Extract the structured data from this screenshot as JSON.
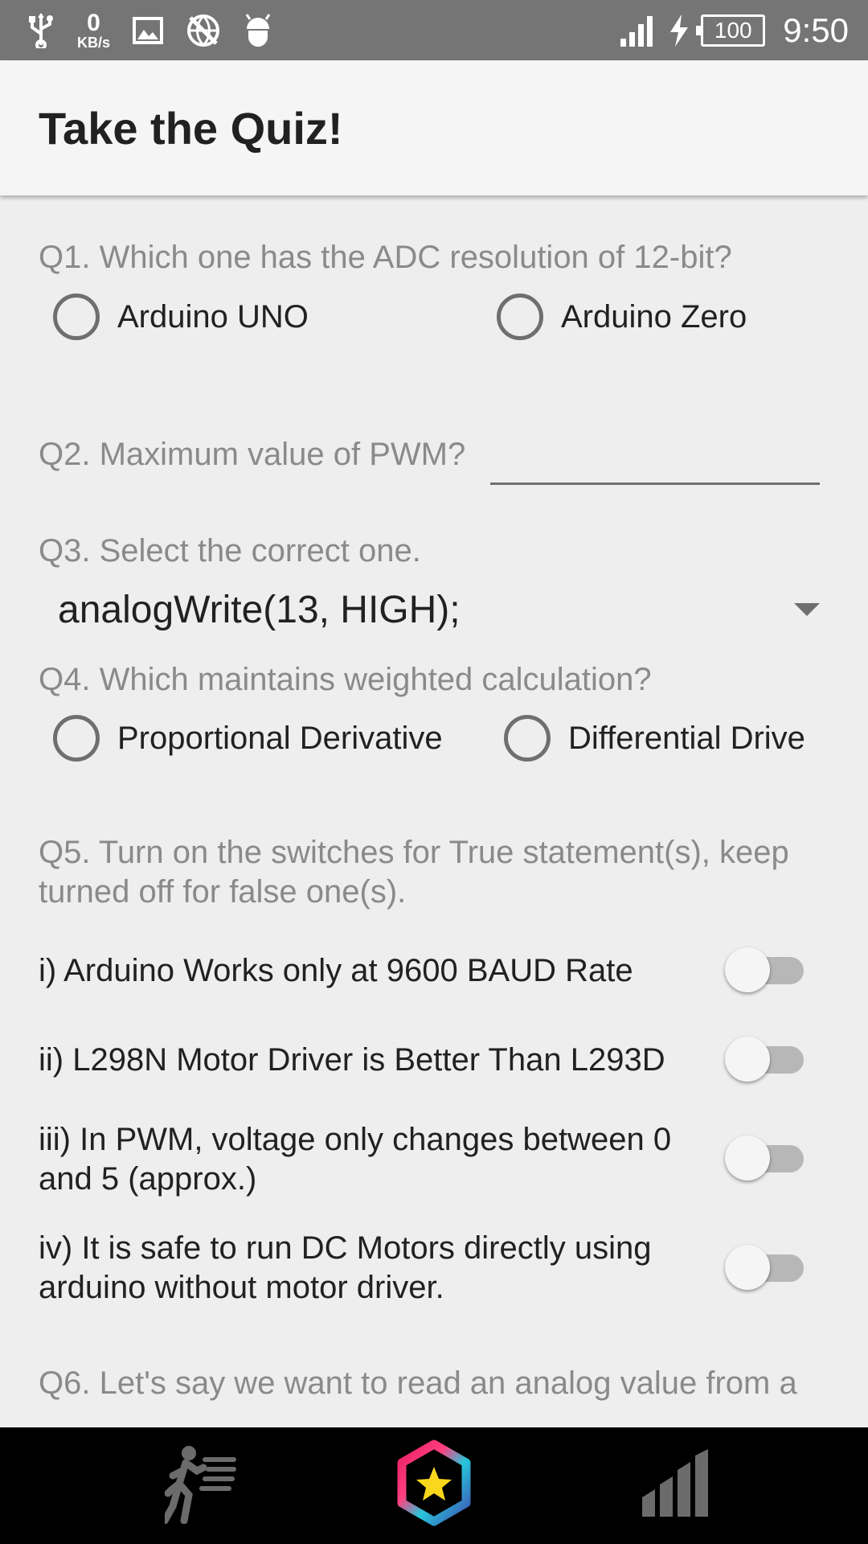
{
  "status_bar": {
    "speed_value": "0",
    "speed_unit": "KB/s",
    "battery": "100",
    "time": "9:50",
    "icons": [
      "usb-icon",
      "image-icon",
      "no-data-icon",
      "android-icon",
      "signal-icon",
      "charging-icon",
      "battery-icon"
    ]
  },
  "app_bar": {
    "title": "Take the Quiz!"
  },
  "quiz": {
    "q1": {
      "text": "Q1. Which one has the ADC resolution of 12-bit?",
      "options": [
        "Arduino UNO",
        "Arduino Zero"
      ]
    },
    "q2": {
      "text": "Q2. Maximum value of PWM?",
      "answer": ""
    },
    "q3": {
      "text": "Q3. Select the correct one.",
      "selected": "analogWrite(13, HIGH);"
    },
    "q4": {
      "text": "Q4. Which maintains weighted calculation?",
      "options": [
        "Proportional Derivative",
        "Differential Drive"
      ]
    },
    "q5": {
      "text": "Q5. Turn on the switches for True statement(s), keep turned off for false one(s).",
      "statements": [
        {
          "text": "i) Arduino Works only at 9600 BAUD Rate",
          "on": false
        },
        {
          "text": "ii) L298N Motor Driver is Better Than L293D",
          "on": false
        },
        {
          "text": "iii) In PWM, voltage only changes between 0 and 5 (approx.)",
          "on": false
        },
        {
          "text": "iv) It is safe to run DC Motors directly using arduino without motor driver.",
          "on": false
        }
      ]
    },
    "q6": {
      "text": "Q6. Let's say we want to read an analog value from a"
    }
  },
  "bottom_nav": {
    "items": [
      "runner-icon",
      "star-hexagon-icon",
      "bar-chart-icon"
    ]
  },
  "colors": {
    "status_bar": "#757575",
    "app_bar": "#f5f5f5",
    "background": "#eeeeee",
    "bottom_nav": "#000000",
    "star": "#f9d71c"
  }
}
